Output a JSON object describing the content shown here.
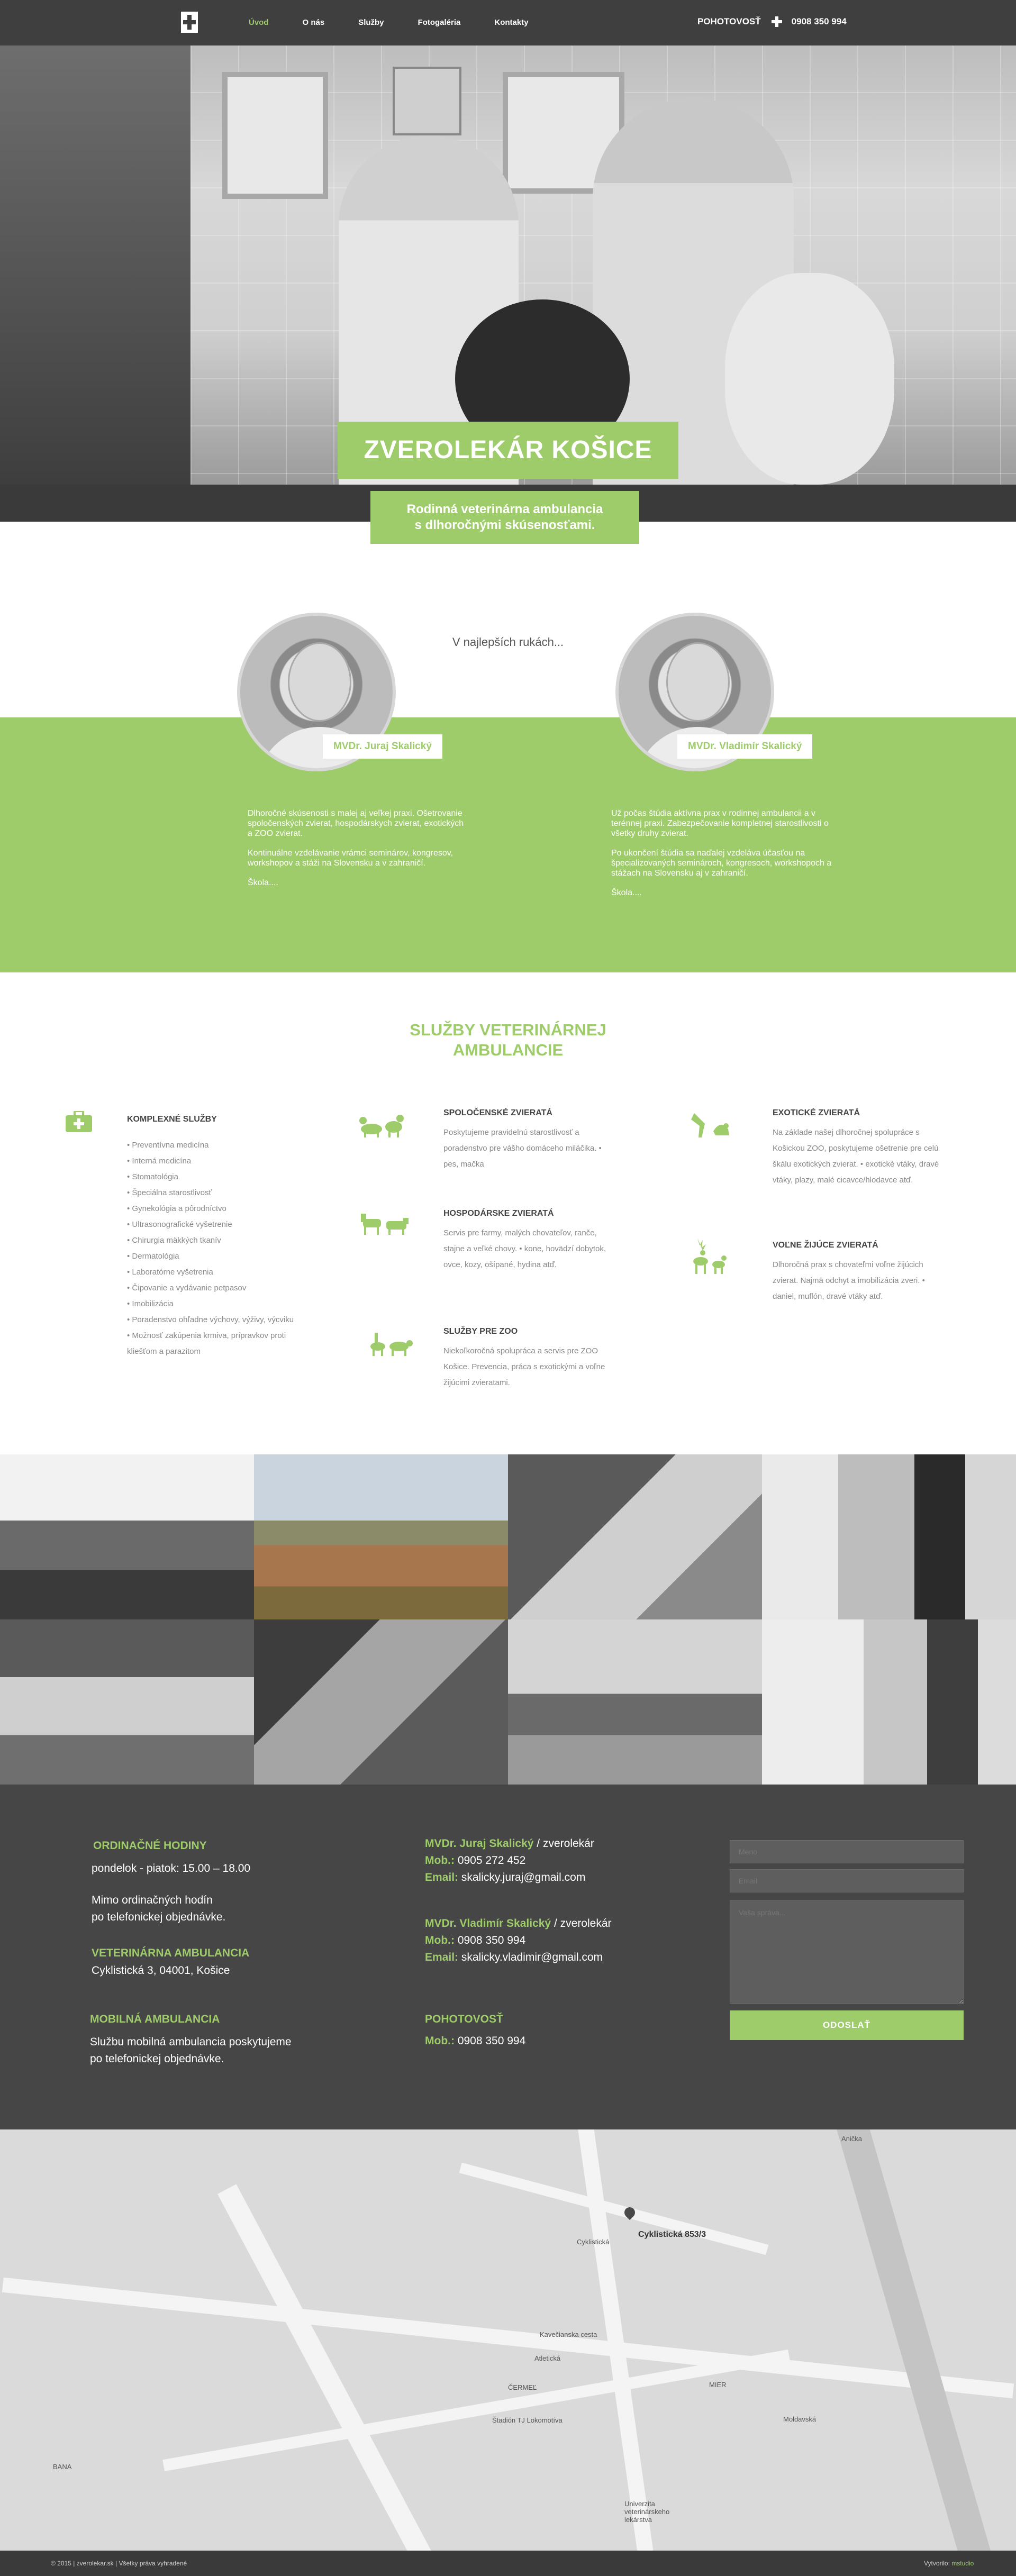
{
  "nav": {
    "items": [
      {
        "label": "Úvod",
        "active": true
      },
      {
        "label": "O nás",
        "active": false
      },
      {
        "label": "Služby",
        "active": false
      },
      {
        "label": "Fotogaléria",
        "active": false
      },
      {
        "label": "Kontakty",
        "active": false
      }
    ],
    "emergency_label": "POHOTOVOSŤ",
    "emergency_phone": "0908 350 994"
  },
  "hero": {
    "title": "ZVEROLEKÁR KOŠICE",
    "subtitle_line1": "Rodinná veterinárna ambulancia",
    "subtitle_line2": "s dlhoročnými skúsenosťami."
  },
  "doctors": {
    "tagline": "V najlepších rukách...",
    "left": {
      "name": "MVDr. Juraj Skalický",
      "p1": "Dlhoročné skúsenosti s malej aj veľkej praxi. Ošetrovanie spoločenských zvierat, hospodárskych zvierat, exotických a ZOO zvierat.",
      "p2": "Kontinuálne vzdelávanie vrámci seminárov, kongresov, workshopov a stáži na Slovensku a v zahraničí.",
      "p3": "Škola...."
    },
    "right": {
      "name": "MVDr. Vladimír Skalický",
      "p1": "Už počas štúdia aktívna prax v rodinnej ambulancii a v terénnej praxi. Zabezpečovanie kompletnej starostlivosti o všetky druhy zvierat.",
      "p2": "Po ukončení štúdia sa naďalej vzdeláva účasťou na špecializovaných seminároch, kongresoch, workshopoch a stážach na Slovensku aj v zahraničí.",
      "p3": "Škola...."
    }
  },
  "services": {
    "title_line1": "SLUŽBY VETERINÁRNEJ",
    "title_line2": "AMBULANCIE",
    "complex": {
      "heading": "KOMPLEXNÉ SLUŽBY",
      "items": [
        "• Preventívna medicína",
        "• Interná medicína",
        "• Stomatológia",
        "• Špeciálna starostlivosť",
        "• Gynekológia a pôrodníctvo",
        "• Ultrasonografické vyšetrenie",
        "• Chirurgia mäkkých tkanív",
        "• Dermatológia",
        "• Laboratórne vyšetrenia",
        "• Čipovanie a vydávanie petpasov",
        "• Imobilizácia",
        "• Poradenstvo ohľadne výchovy, výživy, výcviku",
        "• Možnosť zakúpenia krmiva, prípravkov proti kliešťom a parazitom"
      ]
    },
    "companion": {
      "heading": "SPOLOČENSKÉ ZVIERATÁ",
      "text": "Poskytujeme pravidelnú starostlivosť a poradenstvo pre vášho domáceho miláčika. • pes, mačka"
    },
    "farm": {
      "heading": "HOSPODÁRSKE ZVIERATÁ",
      "text": "Servis pre farmy, malých chovateľov, ranče, stajne a veľké chovy. • kone, hovädzí dobytok, ovce, kozy, ošípané, hydina atď."
    },
    "zoo": {
      "heading": "SLUŽBY PRE ZOO",
      "text": "Niekoľkoročná spolupráca a servis pre ZOO Košice. Prevencia, práca s exotickými a voľne žijúcimi zvieratami."
    },
    "exotic": {
      "heading": "EXOTICKÉ ZVIERATÁ",
      "text": "Na základe našej dlhoročnej spolupráce s Košickou ZOO, poskytujeme ošetrenie pre celú škálu exotických zvierat. • exotické vtáky, dravé vtáky, plazy, malé cicavce/hlodavce atď."
    },
    "wild": {
      "heading": "VOĽNE ŽIJÚCE ZVIERATÁ",
      "text": "Dlhoročná prax s chovateľmi voľne žijúcich zvierat. Najmä odchyt a imobilizácia zveri. • daniel, muflón, dravé vtáky atď."
    }
  },
  "contact": {
    "hours_heading": "ORDINAČNÉ HODINY",
    "hours_text": "pondelok - piatok: 15.00 – 18.00",
    "hours_note_line1": "Mimo ordinačných hodín",
    "hours_note_line2": "po telefonickej objednávke.",
    "clinic_heading": "VETERINÁRNA AMBULANCIA",
    "clinic_address": "Cyklistická 3, 04001, Košice",
    "mobile_heading": "MOBILNÁ AMBULANCIA",
    "mobile_line1": "Službu mobilná ambulancia poskytujeme",
    "mobile_line2": "po telefonickej objednávke.",
    "doc1_name": "MVDr. Juraj Skalický",
    "doc1_role": "/ zverolekár",
    "doc1_mob_label": "Mob.:",
    "doc1_mob": "0905 272 452",
    "doc1_email_label": "Email:",
    "doc1_email": "skalicky.juraj@gmail.com",
    "doc2_name": "MVDr. Vladimír Skalický",
    "doc2_role": "/ zverolekár",
    "doc2_mob_label": "Mob.:",
    "doc2_mob": "0908 350 994",
    "doc2_email_label": "Email:",
    "doc2_email": "skalicky.vladimir@gmail.com",
    "emergency_heading": "POHOTOVOSŤ",
    "emergency_mob_label": "Mob.:",
    "emergency_mob": "0908 350 994",
    "form": {
      "name_placeholder": "Meno",
      "email_placeholder": "Email",
      "message_placeholder": "Vaša správa...",
      "submit_label": "ODOSLAŤ"
    }
  },
  "map": {
    "pin_label": "Cyklistická 853/3",
    "labels": [
      "Cyklistická",
      "Kavečianska cesta",
      "Atletická",
      "ČERMEĽ",
      "Štadión TJ Lokomotíva",
      "Univerzita veterinárskeho lekárstva",
      "Anička",
      "Moldavská",
      "MIER",
      "BANA"
    ]
  },
  "footer": {
    "copyright": "© 2015 | zverolekar.sk | Všetky práva vyhradené",
    "credit_prefix": "Vytvorilo:",
    "credit_name": "mstudio"
  },
  "colors": {
    "accent": "#9fcc6b",
    "nav_bg": "#3f3f3f",
    "footer_bg": "#464646"
  }
}
